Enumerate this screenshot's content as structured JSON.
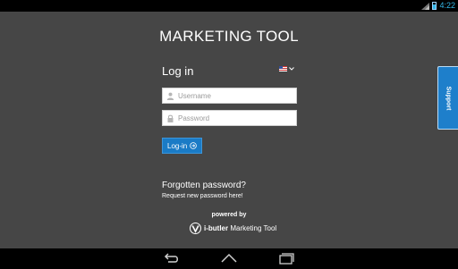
{
  "status_bar": {
    "time": "4:22"
  },
  "app": {
    "title": "MARKETING TOOL"
  },
  "login": {
    "heading": "Log in",
    "username_placeholder": "Username",
    "password_placeholder": "Password",
    "button_label": "Log-in",
    "language": {
      "icon": "us-flag-icon"
    }
  },
  "forgot": {
    "title": "Forgotten password?",
    "link": "Request new password here!"
  },
  "footer": {
    "powered_by": "powered by",
    "brand_bold": "i-butler",
    "brand_rest": " Marketing Tool"
  },
  "support": {
    "label": "Support"
  },
  "colors": {
    "background": "#464646",
    "accent": "#1a7bc6",
    "status_time": "#33b5e5"
  },
  "nav": {
    "icons": [
      "back-icon",
      "home-icon",
      "recents-icon"
    ]
  }
}
